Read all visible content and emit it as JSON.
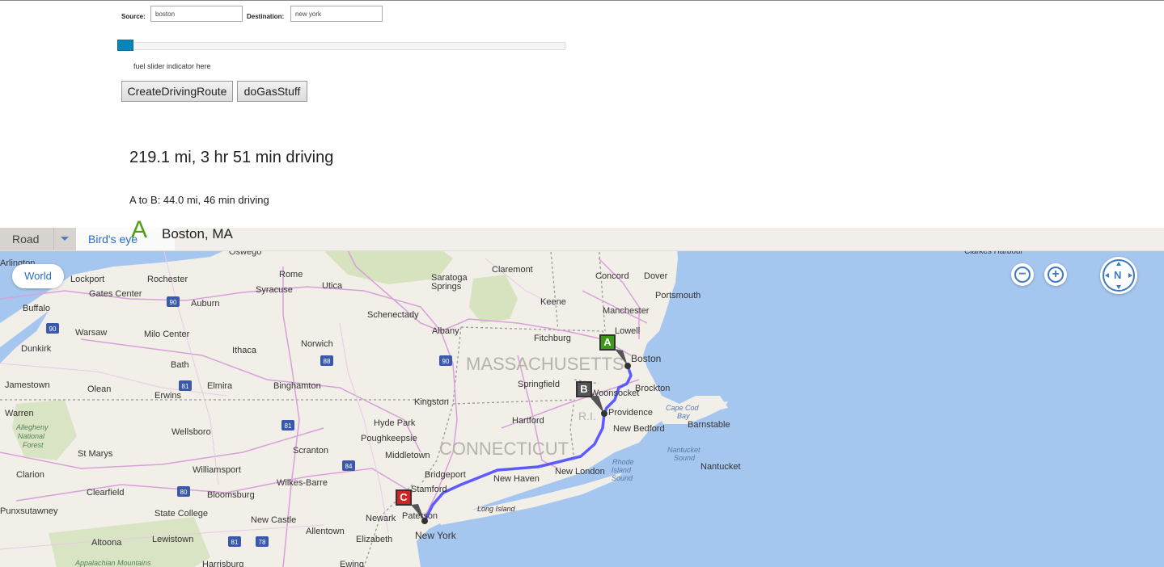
{
  "form": {
    "source_label": "Source:",
    "source_value": "boston",
    "destination_label": "Destination:",
    "destination_value": "new york"
  },
  "fuel_slider": {
    "level": 0.0,
    "note": "fuel slider indicator here"
  },
  "buttons": {
    "create_route": "CreateDrivingRoute",
    "gas": "doGasStuff"
  },
  "route_summary": "219.1 mi, 3 hr 51 min driving",
  "leg_summary": "A to B: 44.0 mi, 46 min driving",
  "start_marker": {
    "letter": "A",
    "address": "Boston, MA"
  },
  "map_controls": {
    "road": "Road",
    "birds_eye": "Bird's eye",
    "world": "World",
    "zoom_out": "−",
    "zoom_in": "+",
    "compass": "N"
  },
  "pins": {
    "a": "A",
    "b": "B",
    "c": "C"
  },
  "colors": {
    "route": "#5b5bff",
    "pin_a": "#3b9b17",
    "pin_b": "#555555",
    "pin_c": "#d32424",
    "water": "#a5c6ef",
    "land": "#f2efe9",
    "accent": "#2a6cc9"
  },
  "map_labels": {
    "states": [
      "MASSACHUSETTS",
      "CONNECTICUT",
      "R.I."
    ],
    "cities": [
      "Oswego",
      "Clarkes Harbour",
      "Claremont",
      "Concord",
      "Dover",
      "Portsmouth",
      "Manchester",
      "Lowell",
      "Boston",
      "Brockton",
      "Keene",
      "Fitchburg",
      "Springfield",
      "Woonsocket",
      "Providence",
      "New Bedford",
      "Barnstable",
      "Hartford",
      "New London",
      "New Haven",
      "Bridgeport",
      "Stamford",
      "Paterson",
      "New York",
      "Newark",
      "Elizabeth",
      "Nantucket",
      "Rome",
      "Utica",
      "Syracuse",
      "Saratoga Springs",
      "Schenectady",
      "Albany",
      "Norwich",
      "Kingston",
      "Hyde Park",
      "Poughkeepsie",
      "Middletown",
      "Lockport",
      "Rochester",
      "Gates Center",
      "Auburn",
      "Buffalo",
      "Warsaw",
      "Milo Center",
      "Ithaca",
      "Dunkirk",
      "Bath",
      "Binghamton",
      "Elmira",
      "Erwins",
      "Olean",
      "Jamestown",
      "Warren",
      "Wellsboro",
      "Scranton",
      "Wilkes-Barre",
      "St Marys",
      "Williamsport",
      "Clarion",
      "Clearfield",
      "Bloomsburg",
      "State College",
      "New Castle",
      "Allentown",
      "Lewistown",
      "Altoona",
      "Ewing",
      "Harrisburg",
      "Punxsutawney",
      "Arlington"
    ],
    "water": [
      "Cape Cod Bay",
      "Nantucket Sound",
      "Rhode Island Sound",
      "Long Island"
    ],
    "parks": [
      "Allegheny National Forest",
      "Appalachian Mountains"
    ],
    "highways": [
      "90",
      "90",
      "88",
      "90",
      "84",
      "81",
      "81",
      "80",
      "78",
      "81"
    ]
  }
}
